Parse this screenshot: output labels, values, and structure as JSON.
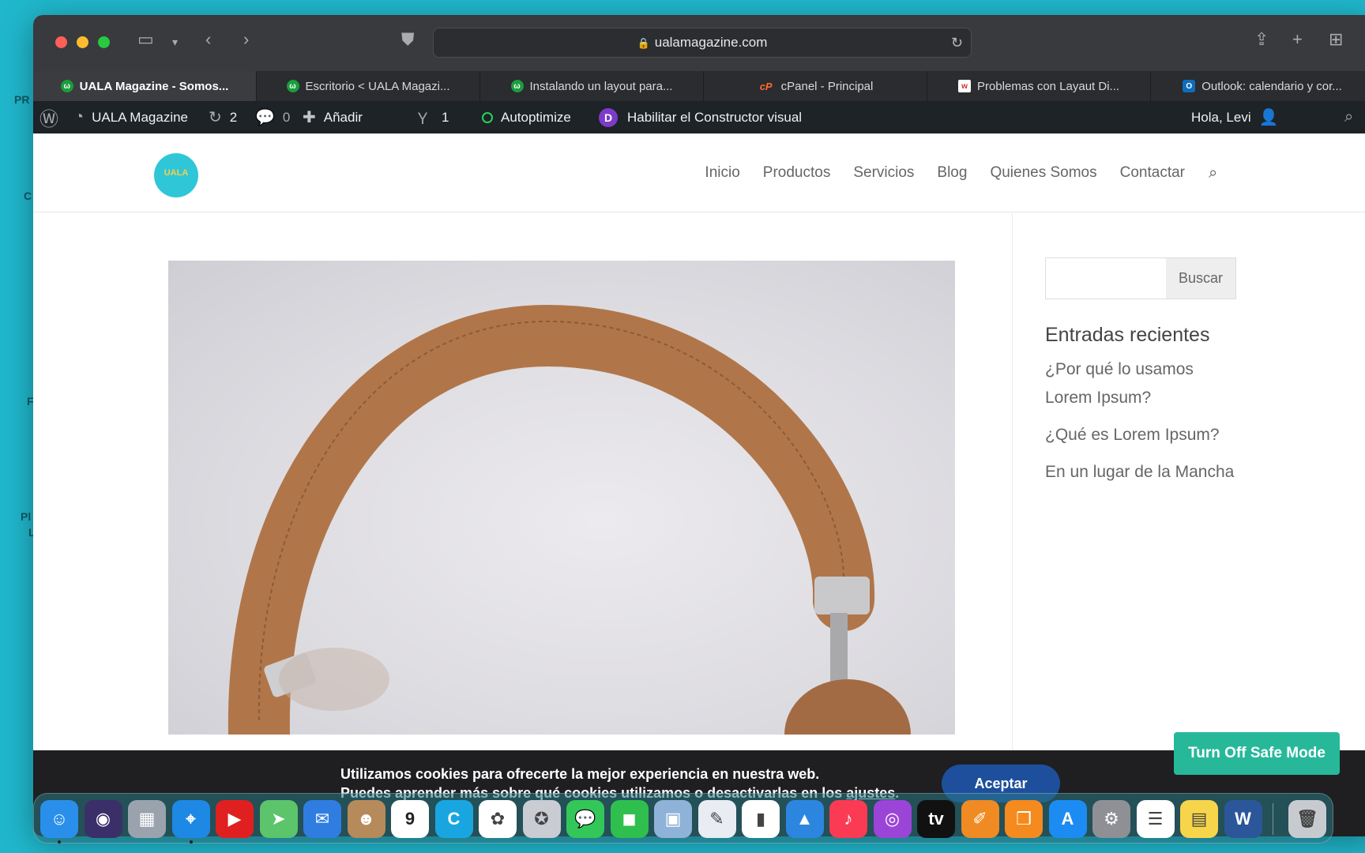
{
  "desktop": {
    "labels": [
      "PR",
      "C",
      "F",
      "Pl",
      "L"
    ]
  },
  "browser": {
    "url": "ualamagazine.com",
    "tabs": [
      {
        "label": "UALA Magazine - Somos...",
        "fav_color": "#1a9e3c",
        "fav_glyph": "ω",
        "active": true
      },
      {
        "label": "Escritorio < UALA Magazi...",
        "fav_color": "#1a9e3c",
        "fav_glyph": "ω",
        "active": false
      },
      {
        "label": "Instalando un layout para...",
        "fav_color": "#1a9e3c",
        "fav_glyph": "ω",
        "active": false
      },
      {
        "label": "cPanel - Principal",
        "fav_color": "#ff6c2c",
        "fav_glyph": "cP",
        "active": false
      },
      {
        "label": "Problemas con Layaut Di...",
        "fav_color": "#d62d2d",
        "fav_glyph": "w",
        "active": false
      },
      {
        "label": "Outlook: calendario y cor...",
        "fav_color": "#0f6cbd",
        "fav_glyph": "O",
        "active": false
      }
    ]
  },
  "adminbar": {
    "site_name": "UALA Magazine",
    "updates_count": "2",
    "comments_count": "0",
    "add_label": "Añadir",
    "yoast_count": "1",
    "autoptimize_label": "Autoptimize",
    "divi_label": "Habilitar el Constructor visual",
    "greeting": "Hola, Levi"
  },
  "site": {
    "logo_text": "UALA",
    "nav": [
      "Inicio",
      "Productos",
      "Servicios",
      "Blog",
      "Quienes Somos",
      "Contactar"
    ],
    "sidebar": {
      "search_button": "Buscar",
      "recent_title": "Entradas recientes",
      "recent_posts": [
        "¿Por qué lo usamos Lorem Ipsum?",
        "¿Qué es Lorem Ipsum?",
        "En un lugar de la Mancha"
      ]
    }
  },
  "cookie": {
    "line1": "Utilizamos cookies para ofrecerte la mejor experiencia en nuestra web.",
    "line2_prefix": "Puedes aprender más sobre qué cookies utilizamos o desactivarlas en los ",
    "link": "ajustes",
    "line2_suffix": ".",
    "accept": "Aceptar"
  },
  "safe_mode": "Turn Off Safe Mode",
  "dock": {
    "apps": [
      {
        "name": "finder-icon",
        "color": "#2a8fea",
        "glyph": "☺"
      },
      {
        "name": "siri-icon",
        "color": "#3b2f6a",
        "glyph": "◉"
      },
      {
        "name": "launchpad-icon",
        "color": "#9aa3ad",
        "glyph": "▦"
      },
      {
        "name": "safari-icon",
        "color": "#1e88e5",
        "glyph": "⌖"
      },
      {
        "name": "youtube-icon",
        "color": "#e02020",
        "glyph": "▶"
      },
      {
        "name": "maps-icon",
        "color": "#5cc46a",
        "glyph": "➤"
      },
      {
        "name": "mail-icon",
        "color": "#2f7de1",
        "glyph": "✉"
      },
      {
        "name": "contacts-icon",
        "color": "#b68a5a",
        "glyph": "☻"
      },
      {
        "name": "calendar-icon",
        "color": "#ffffff",
        "glyph": "9"
      },
      {
        "name": "canva-icon",
        "color": "#19a6e0",
        "glyph": "C"
      },
      {
        "name": "photos-icon",
        "color": "#ffffff",
        "glyph": "✿"
      },
      {
        "name": "instruments-icon",
        "color": "#c9ccd3",
        "glyph": "✪"
      },
      {
        "name": "messages-icon",
        "color": "#33c759",
        "glyph": "💬"
      },
      {
        "name": "facetime-icon",
        "color": "#2fbf4f",
        "glyph": "◼"
      },
      {
        "name": "preview-icon",
        "color": "#8fb3d8",
        "glyph": "▣"
      },
      {
        "name": "textedit-icon",
        "color": "#e9ecf2",
        "glyph": "✎"
      },
      {
        "name": "numbers-icon",
        "color": "#ffffff",
        "glyph": "▮"
      },
      {
        "name": "keynote-icon",
        "color": "#2c86e0",
        "glyph": "▲"
      },
      {
        "name": "music-icon",
        "color": "#fa3b53",
        "glyph": "♪"
      },
      {
        "name": "podcasts-icon",
        "color": "#9b45d8",
        "glyph": "◎"
      },
      {
        "name": "appletv-icon",
        "color": "#111111",
        "glyph": "tv"
      },
      {
        "name": "pages-icon",
        "color": "#f08a22",
        "glyph": "✐"
      },
      {
        "name": "books-icon",
        "color": "#f58a1f",
        "glyph": "❒"
      },
      {
        "name": "appstore-icon",
        "color": "#1c8cf2",
        "glyph": "A"
      },
      {
        "name": "settings-icon",
        "color": "#8e9096",
        "glyph": "⚙"
      },
      {
        "name": "reminders-icon",
        "color": "#ffffff",
        "glyph": "☰"
      },
      {
        "name": "notes-icon",
        "color": "#f7d54a",
        "glyph": "▤"
      },
      {
        "name": "word-icon",
        "color": "#2b579a",
        "glyph": "W"
      },
      {
        "name": "trash-icon",
        "color": "#c7cbd0",
        "glyph": "🗑"
      }
    ]
  }
}
